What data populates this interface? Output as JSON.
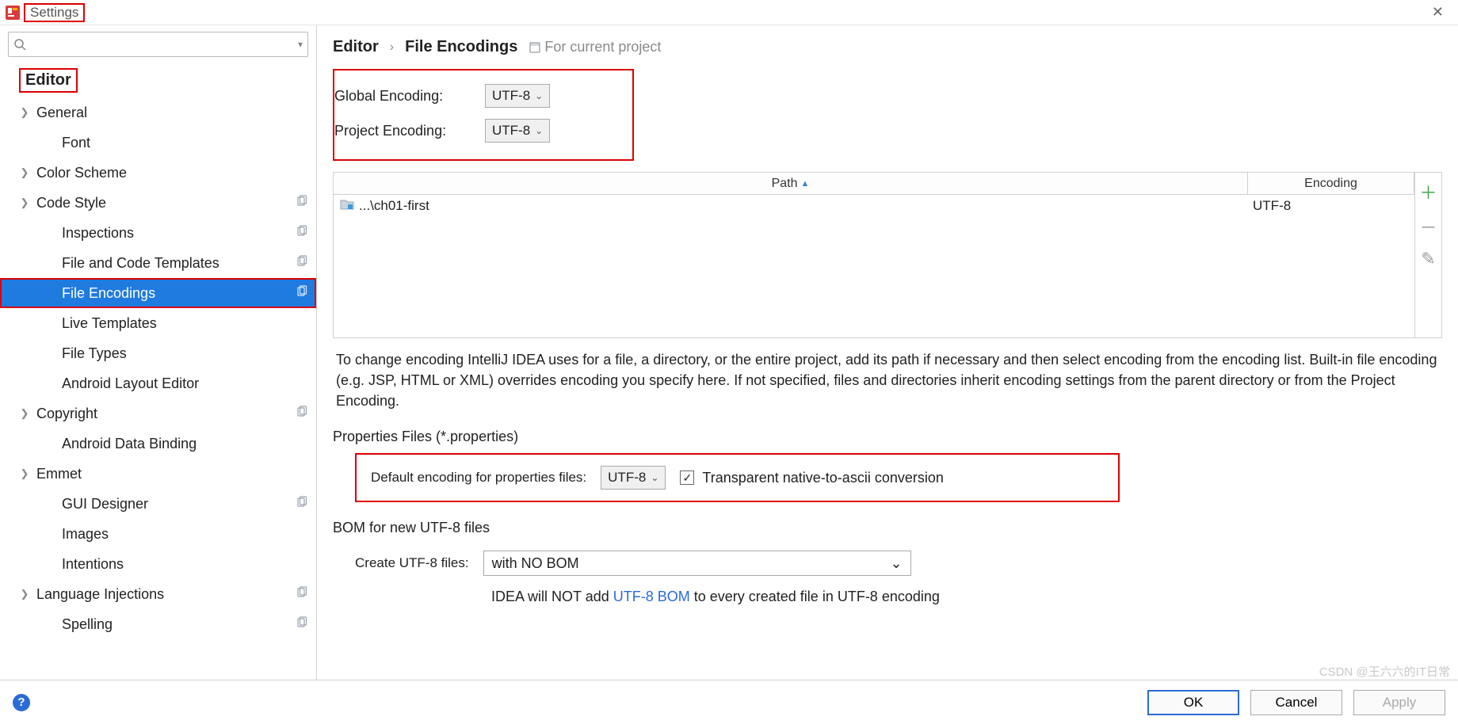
{
  "window": {
    "title": "Settings"
  },
  "search": {
    "placeholder": ""
  },
  "sidebar": {
    "header": "Editor",
    "items": [
      {
        "label": "General",
        "expandable": true,
        "lvl": 1,
        "copy": false
      },
      {
        "label": "Font",
        "expandable": false,
        "lvl": 2,
        "copy": false
      },
      {
        "label": "Color Scheme",
        "expandable": true,
        "lvl": 1,
        "copy": false
      },
      {
        "label": "Code Style",
        "expandable": true,
        "lvl": 1,
        "copy": true
      },
      {
        "label": "Inspections",
        "expandable": false,
        "lvl": 2,
        "copy": true
      },
      {
        "label": "File and Code Templates",
        "expandable": false,
        "lvl": 2,
        "copy": true
      },
      {
        "label": "File Encodings",
        "expandable": false,
        "lvl": 2,
        "copy": true,
        "selected": true
      },
      {
        "label": "Live Templates",
        "expandable": false,
        "lvl": 2,
        "copy": false
      },
      {
        "label": "File Types",
        "expandable": false,
        "lvl": 2,
        "copy": false
      },
      {
        "label": "Android Layout Editor",
        "expandable": false,
        "lvl": 2,
        "copy": false
      },
      {
        "label": "Copyright",
        "expandable": true,
        "lvl": 1,
        "copy": true
      },
      {
        "label": "Android Data Binding",
        "expandable": false,
        "lvl": 2,
        "copy": false
      },
      {
        "label": "Emmet",
        "expandable": true,
        "lvl": 1,
        "copy": false
      },
      {
        "label": "GUI Designer",
        "expandable": false,
        "lvl": 2,
        "copy": true
      },
      {
        "label": "Images",
        "expandable": false,
        "lvl": 2,
        "copy": false
      },
      {
        "label": "Intentions",
        "expandable": false,
        "lvl": 2,
        "copy": false
      },
      {
        "label": "Language Injections",
        "expandable": true,
        "lvl": 1,
        "copy": true
      },
      {
        "label": "Spelling",
        "expandable": false,
        "lvl": 2,
        "copy": true
      }
    ]
  },
  "breadcrumb": {
    "root": "Editor",
    "leaf": "File Encodings",
    "hint": "For current project"
  },
  "enc": {
    "global_label": "Global Encoding:",
    "global_value": "UTF-8",
    "project_label": "Project Encoding:",
    "project_value": "UTF-8"
  },
  "table": {
    "col_path": "Path",
    "col_enc": "Encoding",
    "rows": [
      {
        "path": "...\\ch01-first",
        "encoding": "UTF-8"
      }
    ]
  },
  "description": "To change encoding IntelliJ IDEA uses for a file, a directory, or the entire project, add its path if necessary and then select encoding from the encoding list. Built-in file encoding (e.g. JSP, HTML or XML) overrides encoding you specify here. If not specified, files and directories inherit encoding settings from the parent directory or from the Project Encoding.",
  "properties": {
    "title": "Properties Files (*.properties)",
    "label": "Default encoding for properties files:",
    "value": "UTF-8",
    "checkbox_label": "Transparent native-to-ascii conversion",
    "checkbox_checked": true
  },
  "bom": {
    "title": "BOM for new UTF-8 files",
    "label": "Create UTF-8 files:",
    "value": "with NO BOM",
    "note_pre": "IDEA will NOT add ",
    "note_link": "UTF-8 BOM",
    "note_post": " to every created file in UTF-8 encoding"
  },
  "buttons": {
    "ok": "OK",
    "cancel": "Cancel",
    "apply": "Apply"
  },
  "watermark": "CSDN @王六六的IT日常"
}
